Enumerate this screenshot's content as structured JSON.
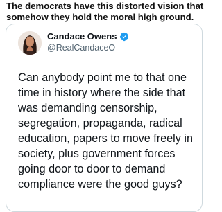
{
  "caption": {
    "line1": "The democrats have this distorted vision that",
    "line2": "somehow they hold the moral high ground."
  },
  "tweet": {
    "display_name": "Candace Owens",
    "handle": "@RealCandaceO",
    "verified": true,
    "text_lines": [
      "Can anybody point me to that one",
      "time in history where the side that",
      "was demanding censorship,",
      "segregation, propaganda, radical",
      "education, papers to move freely in",
      "society, plus government forces",
      "going door to door to demand",
      "compliance were the good guys?"
    ]
  },
  "colors": {
    "verified_badge": "#1d9bf0",
    "handle_text": "#536471",
    "border": "#cfd9de"
  },
  "icons": {
    "verified": "verified-badge-icon",
    "avatar": "avatar"
  }
}
